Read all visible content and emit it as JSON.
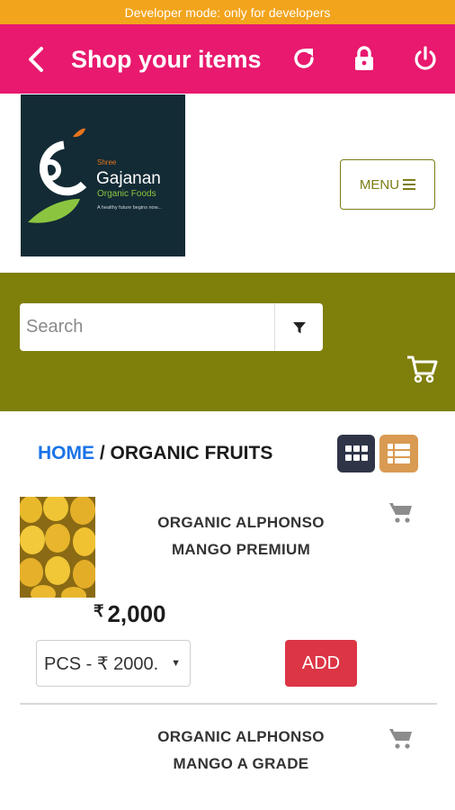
{
  "dev_banner": "Developer mode: only for developers",
  "appbar": {
    "title": "Shop your items",
    "back_icon": "chevron-left-icon",
    "refresh_icon": "refresh-icon",
    "lock_icon": "lock-icon",
    "power_icon": "power-icon",
    "bg_color": "#e8196e"
  },
  "logo": {
    "brand_small": "Shree",
    "brand_main": "Gajanan",
    "brand_sub": "Organic Foods",
    "tagline": "A healthy future begins now..."
  },
  "menu_button": "MENU",
  "search": {
    "placeholder": "Search",
    "filter_icon": "filter-icon",
    "cart_icon": "cart-icon"
  },
  "breadcrumb": {
    "home": "HOME",
    "separator": " / ",
    "current": "ORGANIC FRUITS"
  },
  "products": [
    {
      "name_line1": "ORGANIC ALPHONSO",
      "name_line2": "MANGO PREMIUM",
      "currency": "₹",
      "price": "2,000",
      "option": "PCS - ₹ 2000.",
      "add_label": "ADD"
    },
    {
      "name_line1": "ORGANIC ALPHONSO",
      "name_line2": "MANGO A GRADE"
    }
  ],
  "colors": {
    "accent_olive": "#7f7f0c",
    "add_red": "#dc3545",
    "home_blue": "#1a73e8",
    "dev_orange": "#f2a41c"
  }
}
